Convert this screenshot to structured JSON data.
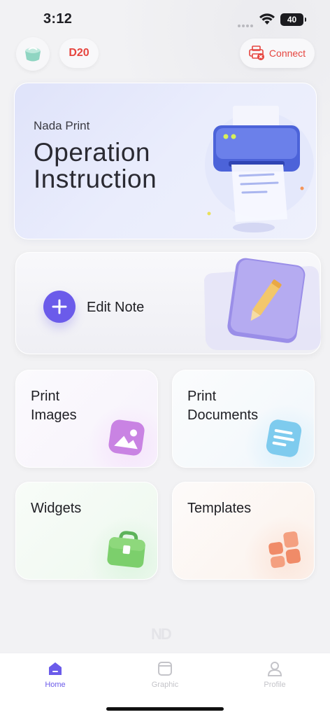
{
  "status": {
    "time": "3:12",
    "battery": "40"
  },
  "header": {
    "device": "D20",
    "connect_label": "Connect"
  },
  "hero": {
    "subtitle": "Nada Print",
    "title_line1": "Operation",
    "title_line2": "Instruction"
  },
  "edit_note": {
    "label": "Edit Note"
  },
  "tiles": [
    {
      "line1": "Print",
      "line2": "Images"
    },
    {
      "line1": "Print",
      "line2": "Documents"
    },
    {
      "line1": "Widgets"
    },
    {
      "line1": "Templates"
    }
  ],
  "watermark": "ND",
  "tabs": [
    {
      "label": "Home",
      "active": true
    },
    {
      "label": "Graphic",
      "active": false
    },
    {
      "label": "Profile",
      "active": false
    }
  ],
  "colors": {
    "accent": "#6b5bea",
    "connect": "#e6453f"
  }
}
